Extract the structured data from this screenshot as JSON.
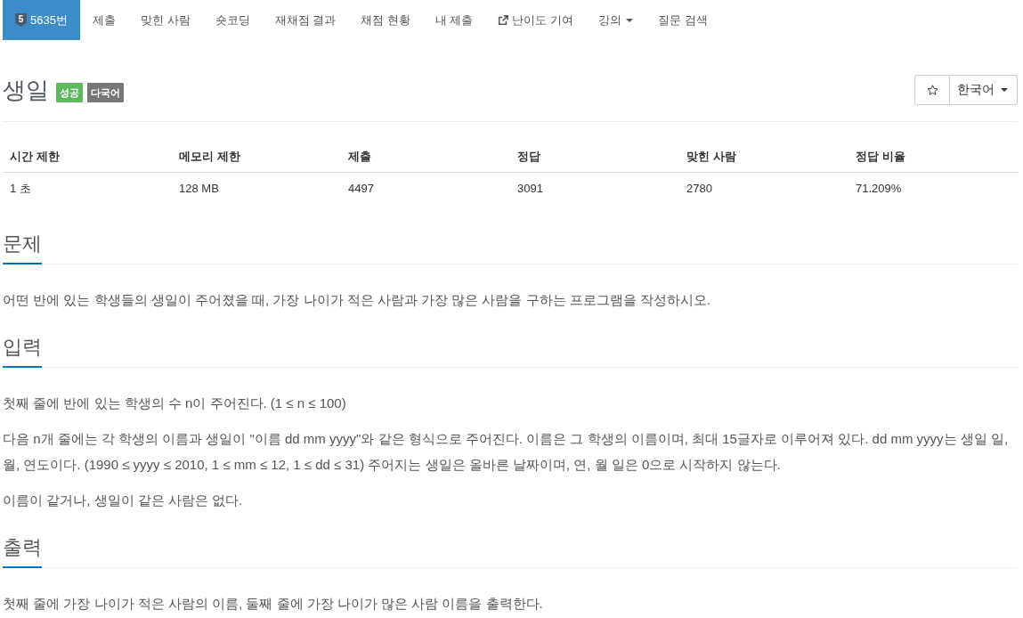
{
  "nav": {
    "items": [
      {
        "label": "5635번",
        "kind": "problem",
        "tier": "5",
        "selected": true
      },
      {
        "label": "제출",
        "kind": "link",
        "selected": false
      },
      {
        "label": "맞힌 사람",
        "kind": "link",
        "selected": false
      },
      {
        "label": "숏코딩",
        "kind": "link",
        "selected": false
      },
      {
        "label": "재채점 결과",
        "kind": "link",
        "selected": false
      },
      {
        "label": "채점 현황",
        "kind": "link",
        "selected": false
      },
      {
        "label": "내 제출",
        "kind": "link",
        "selected": false
      },
      {
        "label": "난이도 기여",
        "kind": "external",
        "selected": false
      },
      {
        "label": "강의",
        "kind": "dropdown",
        "selected": false
      },
      {
        "label": "질문 검색",
        "kind": "link",
        "selected": false
      }
    ]
  },
  "problem": {
    "title": "생일",
    "labels": [
      {
        "text": "성공",
        "color": "#5cb85c"
      },
      {
        "text": "다국어",
        "color": "#777777"
      }
    ],
    "language": "한국어"
  },
  "stats": {
    "columns": [
      "시간 제한",
      "메모리 제한",
      "제출",
      "정답",
      "맞힌 사람",
      "정답 비율"
    ],
    "rows": [
      [
        "1 초",
        "128 MB",
        "4497",
        "3091",
        "2780",
        "71.209%"
      ]
    ]
  },
  "sections": [
    {
      "heading": "문제",
      "paragraphs": [
        "어떤 반에 있는 학생들의 생일이 주어졌을 때, 가장 나이가 적은 사람과 가장 많은 사람을 구하는 프로그램을 작성하시오."
      ]
    },
    {
      "heading": "입력",
      "paragraphs": [
        "첫째 줄에 반에 있는 학생의 수 n이 주어진다. (1 ≤ n ≤ 100)",
        "다음 n개 줄에는 각 학생의 이름과 생일이 \"이름 dd mm yyyy\"와 같은 형식으로 주어진다. 이름은 그 학생의 이름이며, 최대 15글자로 이루어져 있다. dd mm yyyy는 생일 일, 월, 연도이다. (1990 ≤ yyyy ≤ 2010, 1 ≤ mm ≤ 12, 1 ≤ dd ≤ 31) 주어지는 생일은 올바른 날짜이며, 연, 월 일은 0으로 시작하지 않는다.",
        "이름이 같거나, 생일이 같은 사람은 없다."
      ]
    },
    {
      "heading": "출력",
      "paragraphs": [
        "첫째 줄에 가장 나이가 적은 사람의 이름, 둘째 줄에 가장 나이가 많은 사람 이름을 출력한다."
      ]
    }
  ]
}
